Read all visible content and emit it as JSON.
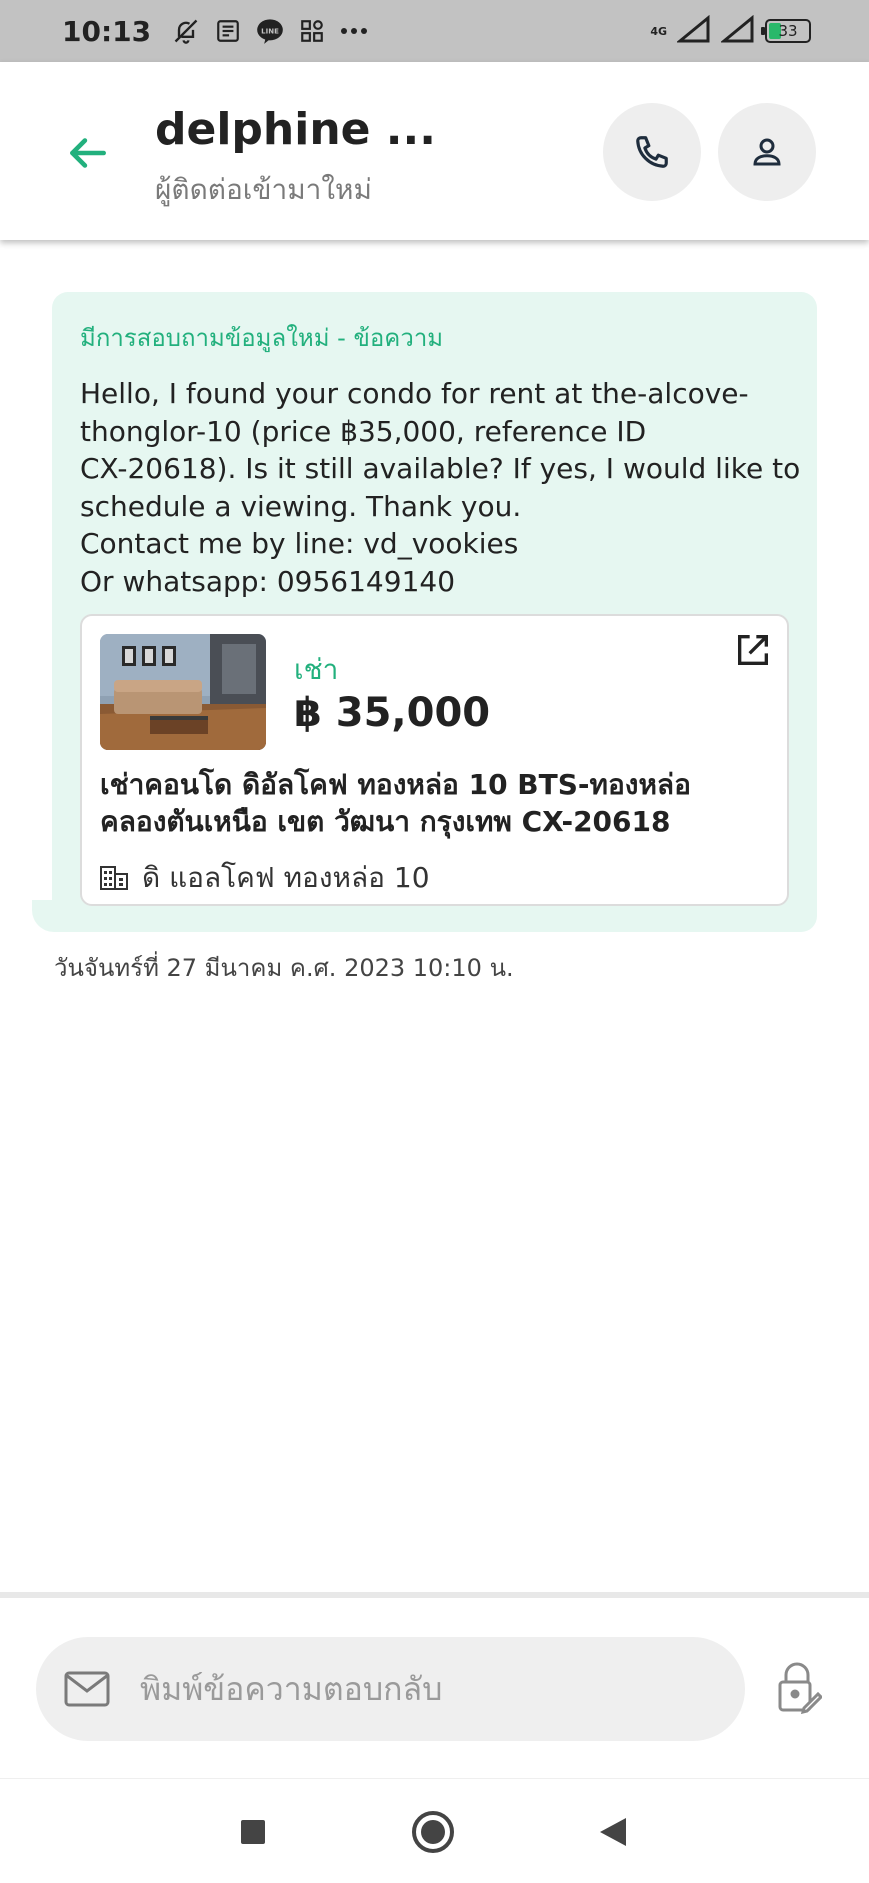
{
  "status_bar": {
    "time": "10:13",
    "network": "4G",
    "battery": "33",
    "icons": [
      "bell-off-icon",
      "news-icon",
      "line-icon",
      "apps-icon",
      "more-icon"
    ]
  },
  "header": {
    "contact_name": "delphine ...",
    "contact_subtitle": "ผู้ติดต่อเข้ามาใหม่"
  },
  "message": {
    "inquiry_title": "มีการสอบถามข้อมูลใหม่ - ข้อความ",
    "lines": [
      "Hello, I found your condo for rent at the-alcove-",
      "thonglor-10 (price ฿35,000, reference ID",
      "CX-20618). Is it still available? If yes, I would like to",
      "schedule a viewing. Thank you.",
      "Contact me by line: vd_vookies",
      "Or whatsapp: 0956149140"
    ],
    "timestamp": "วันจันทร์ที่ 27 มีนาคม ค.ศ. 2023 10:10 น."
  },
  "listing_card": {
    "type": "เช่า",
    "price": "฿ 35,000",
    "title_lines": [
      "เช่าคอนโด  ดิอัลโคฟ ทองหล่อ 10 BTS-ทองหล่อ",
      "คลองตันเหนือ เขต วัฒนา กรุงเทพ CX-20618"
    ],
    "project": "ดิ แอลโคฟ ทองหล่อ 10"
  },
  "composer": {
    "placeholder": "พิมพ์ข้อความตอบกลับ"
  },
  "colors": {
    "accent": "#22b07d",
    "bubble": "#e6f7f1",
    "status_bar": "#c2c2c2"
  }
}
